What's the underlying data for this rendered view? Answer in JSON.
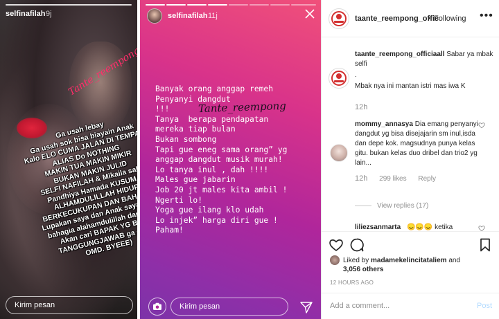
{
  "story1": {
    "username": "selfinafilah",
    "time": "9j",
    "sticker": "Tante_reempong",
    "caption_lines": [
      "Ga usah lebay",
      "Ga usah sok bisa biayain Anak",
      "Kalo ELO CUMA JALAN DI TEMPAT",
      "ALIAS Do NOTHING",
      "MAKIN TUA MAKIN MIKIR",
      "BUKAN MAKIN JULID",
      "SELFI NAFILAH & Mikaila saka",
      "Pandhiya Hamada KUSUMA",
      "ALHAMDULILLAH HIDUP",
      "BERKECUKUPAN DAN BAHAGIA",
      "Lupakan saya dan Anak saya . Kita",
      "bahagia alahamdulillah dan saya",
      "Akan cari BAPAK YG BISA",
      "TANGGUNGJAWAB ga cuma",
      "OMD. BYEEE)"
    ],
    "message_placeholder": "Kirim pesan"
  },
  "story2": {
    "username": "selfinafilah",
    "time": "11j",
    "sticker": "Tante_reempong",
    "text": "Banyak orang anggap remeh\nPenyanyi dangdut\n!!!\nTanya  berapa pendapatan\nmereka tiap bulan\nBukan sombong\nTapi gue eneg sama orang” yg\nanggap dangdut musik murah!\nLo tanya inul , dah !!!!\nMales gue jabarin\nJob 20 jt males kita ambil !\nNgerti lo!\nYoga gue ilang klo udah\nLo injek” harga diri gue !\nPaham!",
    "message_placeholder": "Kirim pesan"
  },
  "post": {
    "account": "taante_reempong_offic",
    "follow_status": "Following",
    "comments": [
      {
        "user": "taante_reempong_officiaall",
        "text": "Sabar ya mbak selfi",
        "extra_lines": [
          ".",
          "Mbak nya ini mantan istri mas iwa K"
        ],
        "time": "12h"
      },
      {
        "user": "mommy_annasya",
        "text": "Dia emang penyanyi dangdut yg bisa disejajarin sm inul,isda dan depe kok. magsudnya punya kelas gitu. bukan kelas duo dribel dan trio2 yg lain...",
        "time": "12h",
        "likes": "299 likes",
        "reply": "Reply",
        "view_replies": "View replies (17)"
      },
      {
        "user": "liliezsanmarta",
        "text": "😞😞😞 ketika"
      }
    ],
    "liked_by_prefix": "Liked by",
    "liked_by_user": "madamekelincitataliem",
    "liked_by_and": "and",
    "likes_count": "3,056 others",
    "timestamp": "12 HOURS AGO",
    "add_comment_placeholder": "Add a comment...",
    "post_button": "Post"
  },
  "colors": {
    "story2_gradient_top": "#f0507a",
    "story2_gradient_bottom": "#7c33a8",
    "link_blue_disabled": "#b3dbff",
    "meta_gray": "#8e8e8e"
  }
}
